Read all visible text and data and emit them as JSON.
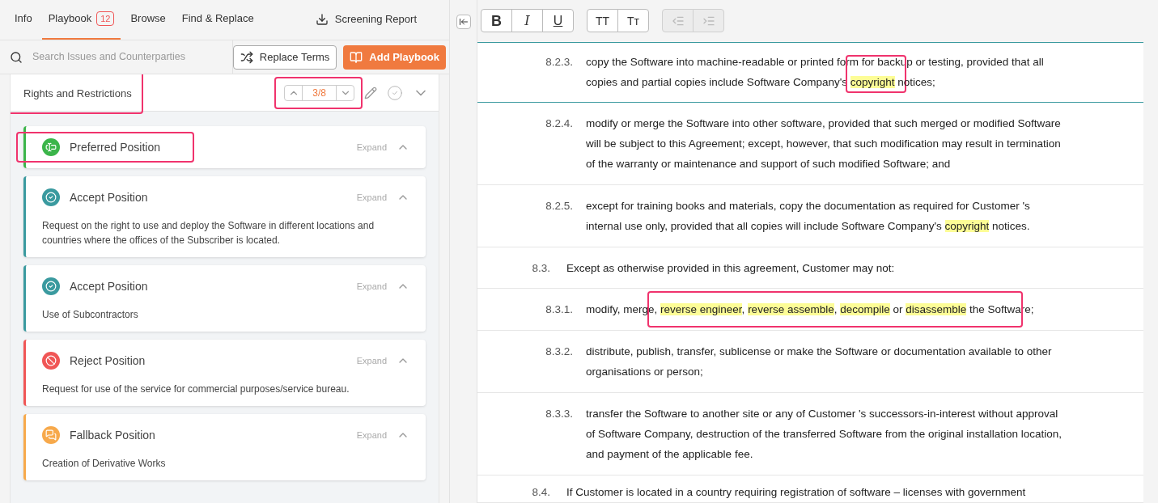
{
  "tabs": [
    {
      "label": "Info",
      "selected": false
    },
    {
      "label": "Playbook",
      "badge": "12",
      "selected": true
    },
    {
      "label": "Browse",
      "selected": false
    },
    {
      "label": "Find & Replace",
      "selected": false
    }
  ],
  "screening_report": {
    "label": "Screening Report"
  },
  "search": {
    "placeholder": "Search Issues and Counterparties"
  },
  "replace_terms": {
    "label": "Replace Terms"
  },
  "add_playbook": {
    "label": "Add Playbook"
  },
  "section": {
    "title": "Rights and Restrictions",
    "title_annotated": true,
    "counter": "3/8",
    "counter_annotated": true
  },
  "cards": [
    {
      "kind": "preferred",
      "color": "#3bb54a",
      "title": "Preferred Position",
      "expand": "Expand",
      "annotated": true
    },
    {
      "kind": "accept",
      "color": "#3a9a9f",
      "title": "Accept Position",
      "expand": "Expand",
      "body": "Request on the right to use and deploy the Software in different locations and countries where the offices of the Subscriber is located."
    },
    {
      "kind": "accept",
      "color": "#3a9a9f",
      "title": "Accept Position",
      "expand": "Expand",
      "body": "Use of Subcontractors"
    },
    {
      "kind": "reject",
      "color": "#f05656",
      "title": "Reject Position",
      "expand": "Expand",
      "body": "Request for use of the service for commercial purposes/service bureau."
    },
    {
      "kind": "fallback",
      "color": "#f7a94b",
      "title": "Fallback Position",
      "expand": "Expand",
      "body": "Creation of Derivative Works"
    }
  ],
  "toolbar": [
    {
      "kind": "bold",
      "label": "B",
      "disabled": false
    },
    {
      "kind": "italic",
      "label": "I",
      "disabled": false
    },
    {
      "kind": "underline",
      "label": "U",
      "disabled": false
    },
    {
      "kind": "upper",
      "label": "TT",
      "disabled": false
    },
    {
      "kind": "smallcaps",
      "label": "Tᴛ",
      "disabled": false
    },
    {
      "kind": "outdent",
      "disabled": true
    },
    {
      "kind": "indent",
      "disabled": true
    }
  ],
  "document": [
    {
      "kind": "subclause",
      "number": "8.2.3.",
      "selected": true,
      "segments": [
        {
          "text": "copy the Software into machine-readable or printed form for backup or testing, provided that all copies and partial copies include Software Company's ",
          "highlighted": false
        },
        {
          "text": "copyright",
          "highlighted": true,
          "annotated": true
        },
        {
          "text": " notices;",
          "highlighted": false
        }
      ]
    },
    {
      "kind": "subclause",
      "number": "8.2.4.",
      "selected": false,
      "segments": [
        {
          "text": "modify or merge the Software into other software, provided that such merged or modified Software will be subject to this Agreement; except, however, that such modification may result in termination of the warranty or maintenance and support of such modified Software; and",
          "highlighted": false
        }
      ]
    },
    {
      "kind": "subclause",
      "number": "8.2.5.",
      "selected": false,
      "segments": [
        {
          "text": "except for training books and materials, copy the documentation as required for Customer 's internal use only, provided that all copies will include Software Company's ",
          "highlighted": false
        },
        {
          "text": "copyright",
          "highlighted": true
        },
        {
          "text": " notices.",
          "highlighted": false
        }
      ]
    },
    {
      "kind": "clause",
      "number": "8.3.",
      "selected": false,
      "segments": [
        {
          "text": "Except as otherwise provided in this agreement, Customer may not:",
          "highlighted": false
        }
      ]
    },
    {
      "kind": "subclause",
      "number": "8.3.1.",
      "selected": false,
      "annotated": true,
      "segments": [
        {
          "text": "modify, merge, ",
          "highlighted": false
        },
        {
          "text": "reverse engineer",
          "highlighted": true
        },
        {
          "text": ", ",
          "highlighted": false
        },
        {
          "text": "reverse assemble",
          "highlighted": true
        },
        {
          "text": ", ",
          "highlighted": false
        },
        {
          "text": "decompile",
          "highlighted": true
        },
        {
          "text": " or ",
          "highlighted": false
        },
        {
          "text": "disassemble",
          "highlighted": true
        },
        {
          "text": " the Software;",
          "highlighted": false
        }
      ]
    },
    {
      "kind": "subclause",
      "number": "8.3.2.",
      "selected": false,
      "segments": [
        {
          "text": "distribute, publish, transfer, sublicense or make the Software or documentation available to other organisations or person;",
          "highlighted": false
        }
      ]
    },
    {
      "kind": "subclause",
      "number": "8.3.3.",
      "selected": false,
      "segments": [
        {
          "text": "transfer the Software to another site or any of Customer 's successors-in-interest without approval of Software Company, destruction of the transferred Software from the original installation location, and payment of the applicable fee.",
          "highlighted": false
        }
      ]
    },
    {
      "kind": "clause",
      "number": "8.4.",
      "selected": false,
      "segments": [
        {
          "text": "If Customer is located in a country requiring registration of software – licenses with government",
          "highlighted": false
        }
      ]
    }
  ]
}
